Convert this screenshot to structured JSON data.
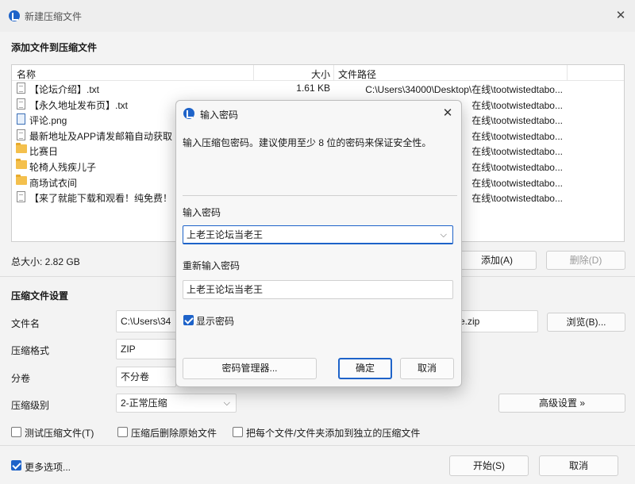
{
  "window": {
    "title": "新建压缩文件"
  },
  "add_section": {
    "title": "添加文件到压缩文件"
  },
  "filelist": {
    "headers": {
      "name": "名称",
      "size": "大小",
      "path": "文件路径"
    },
    "rows": [
      {
        "icon": "file-icon",
        "name": "【论坛介绍】.txt",
        "size": "1.61 KB",
        "path": "C:\\Users\\34000\\Desktop\\在线\\tootwistedtabo..."
      },
      {
        "icon": "file-icon",
        "name": "【永久地址发布页】.txt",
        "size": "",
        "path": "在线\\tootwistedtabo..."
      },
      {
        "icon": "image-file-icon",
        "name": "评论.png",
        "size": "",
        "path": "在线\\tootwistedtabo..."
      },
      {
        "icon": "file-icon",
        "name": "最新地址及APP请发邮箱自动获取",
        "size": "",
        "path": "在线\\tootwistedtabo..."
      },
      {
        "icon": "folder-icon",
        "name": "比赛日",
        "size": "",
        "path": "在线\\tootwistedtabo..."
      },
      {
        "icon": "folder-icon",
        "name": "轮椅人残疾儿子",
        "size": "",
        "path": "在线\\tootwistedtabo..."
      },
      {
        "icon": "folder-icon",
        "name": "商场试衣间",
        "size": "",
        "path": "在线\\tootwistedtabo..."
      },
      {
        "icon": "file-icon",
        "name": "【来了就能下载和观看！纯免费！",
        "size": "",
        "path": "在线\\tootwistedtabo..."
      }
    ]
  },
  "total_size": "总大小: 2.82 GB",
  "buttons": {
    "add": "添加(A)",
    "delete": "删除(D)",
    "browse": "浏览(B)...",
    "advanced": "高级设置 »",
    "start": "开始(S)",
    "cancel": "取消"
  },
  "settings": {
    "title": "压缩文件设置",
    "filename_label": "文件名",
    "filename_value": "C:\\Users\\34",
    "filename_suffix": "e.zip",
    "format_label": "压缩格式",
    "format_value": "ZIP",
    "split_label": "分卷",
    "split_value": "不分卷",
    "level_label": "压缩级别",
    "level_value": "2-正常压缩"
  },
  "checkboxes": {
    "test": "测试压缩文件(T)",
    "delete_after": "压缩后删除原始文件",
    "each_separate": "把每个文件/文件夹添加到独立的压缩文件",
    "more_options": "更多选项..."
  },
  "dialog": {
    "title": "输入密码",
    "description": "输入压缩包密码。建议使用至少 8 位的密码来保证安全性。",
    "password_label": "输入密码",
    "password_value": "上老王论坛当老王",
    "reenter_label": "重新输入密码",
    "reenter_value": "上老王论坛当老王",
    "show_password": "显示密码",
    "manager_button": "密码管理器...",
    "ok_button": "确定",
    "cancel_button": "取消"
  },
  "colors": {
    "accent": "#1e63c9"
  }
}
